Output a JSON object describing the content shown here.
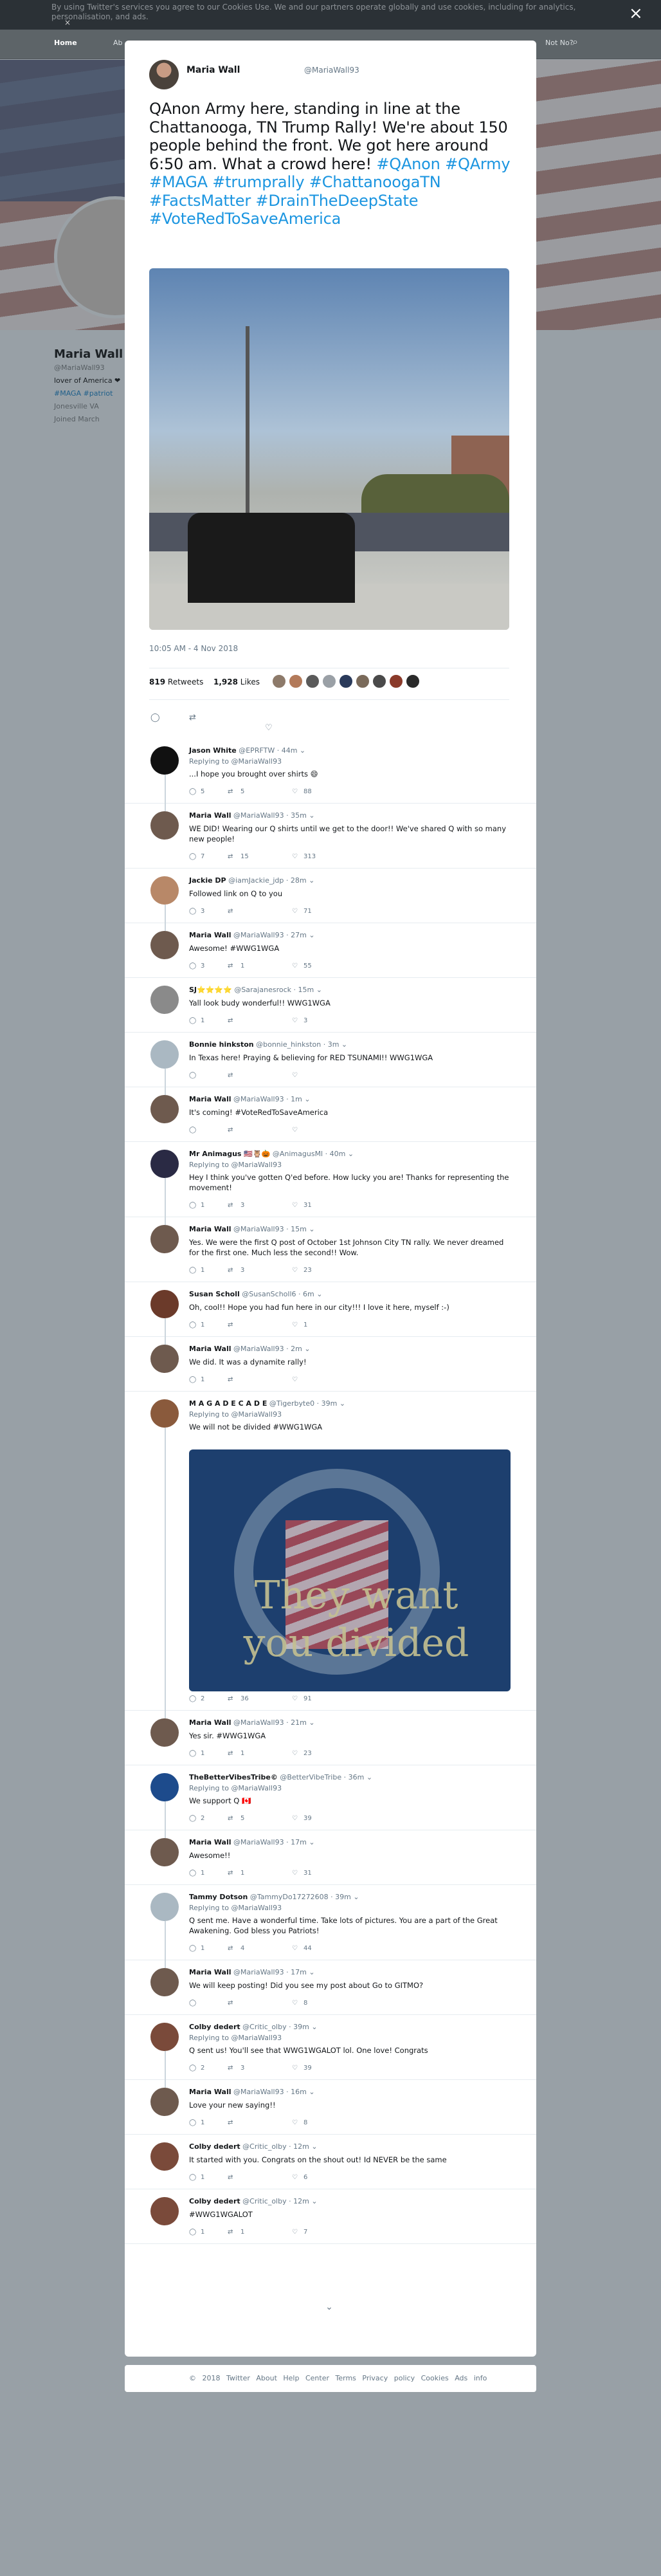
{
  "background": {
    "cookie_text": "By using Twitter's services you agree to our Cookies Use. We and our partners operate globally and use cookies, including for analytics, personalisation, and ads.",
    "cookie_close": "×",
    "nav_home": "Home",
    "nav_about": "Ab",
    "nav_right": "Not No?",
    "profile_name": "Maria Wall",
    "profile_handle": "@MariaWall93",
    "profile_bio": "lover of America ❤",
    "profile_tags": "#MAGA #patriot",
    "profile_location": "Jonesville VA",
    "profile_joined": "Joined March"
  },
  "modal_close": "×",
  "tweet": {
    "author_name": "Maria Wall",
    "author_handle": "@MariaWall93",
    "text_plain": "QAnon Army here, standing in line at the Chattanooga, TN Trump Rally! We're about 150 people behind the front. We got here around 6:50 am. What a crowd here!",
    "hashtags": "#QAnon #QArmy #MAGA #trumprally #ChattanoogaTN #FactsMatter #DrainTheDeepState #VoteRedToSaveAmerica",
    "timestamp": "10:05 AM - 4 Nov 2018",
    "retweets_count": "819",
    "retweets_label": "Retweets",
    "likes_count": "1,928",
    "likes_label": "Likes"
  },
  "replies": [
    {
      "name": "Jason White",
      "handle": "@EPRFTW",
      "time": "44m",
      "replying": "Replying to @MariaWall93",
      "text": "...I hope you brought over shirts 😄",
      "reply": "5",
      "rt": "5",
      "like": "88",
      "color": "#111111",
      "thread": false
    },
    {
      "name": "Maria Wall",
      "handle": "@MariaWall93",
      "time": "35m",
      "replying": "",
      "text": "WE DID! Wearing our Q shirts until we get to the door!! We've shared Q with so many new people!",
      "reply": "7",
      "rt": "15",
      "like": "313",
      "color": "#6e5a4e",
      "thread": true
    },
    {
      "name": "Jackie DP",
      "handle": "@iamJackie_jdp",
      "time": "28m",
      "replying": "",
      "text": "Followed link on Q to you",
      "reply": "3",
      "rt": "",
      "like": "71",
      "color": "#b88868",
      "thread": false
    },
    {
      "name": "Maria Wall",
      "handle": "@MariaWall93",
      "time": "27m",
      "replying": "",
      "text": "Awesome! #WWG1WGA",
      "reply": "3",
      "rt": "1",
      "like": "55",
      "color": "#6e5a4e",
      "thread": true
    },
    {
      "name": "SJ⭐⭐⭐⭐",
      "handle": "@Sarajanesrock",
      "time": "15m",
      "replying": "",
      "text": "Yall look budy wonderful!! WWG1WGA",
      "reply": "1",
      "rt": "",
      "like": "3",
      "color": "#8a8a8a",
      "thread": false
    },
    {
      "name": "Bonnie hinkston",
      "handle": "@bonnie_hinkston",
      "time": "3m",
      "replying": "",
      "text": "In Texas here! Praying & believing for RED TSUNAMI!!  WWG1WGA",
      "reply": "",
      "rt": "",
      "like": "",
      "color": "#aab8c2",
      "thread": false
    },
    {
      "name": "Maria Wall",
      "handle": "@MariaWall93",
      "time": "1m",
      "replying": "",
      "text": "It's coming! #VoteRedToSaveAmerica",
      "reply": "",
      "rt": "",
      "like": "",
      "color": "#6e5a4e",
      "thread": true
    },
    {
      "name": "Mr Animagus 🇺🇸🦉🎃",
      "handle": "@AnimagusMl",
      "time": "40m",
      "replying": "Replying to @MariaWall93",
      "text": "Hey I think you've gotten Q'ed before. How lucky you are! Thanks for representing the movement!",
      "reply": "1",
      "rt": "3",
      "like": "31",
      "color": "#2a2a44",
      "thread": false
    },
    {
      "name": "Maria Wall",
      "handle": "@MariaWall93",
      "time": "15m",
      "replying": "",
      "text": "Yes. We were the first Q post of October 1st  Johnson City TN rally. We never dreamed for the first one.  Much less the second!! Wow.",
      "reply": "1",
      "rt": "3",
      "like": "23",
      "color": "#6e5a4e",
      "thread": true
    },
    {
      "name": "Susan Scholl",
      "handle": "@SusanScholl6",
      "time": "6m",
      "replying": "",
      "text": "Oh, cool!! Hope you had fun here in our city!!! I love it here, myself  :-)",
      "reply": "1",
      "rt": "",
      "like": "1",
      "color": "#6b3a2a",
      "thread": false
    },
    {
      "name": "Maria Wall",
      "handle": "@MariaWall93",
      "time": "2m",
      "replying": "",
      "text": "We did. It was a dynamite rally!",
      "reply": "1",
      "rt": "",
      "like": "",
      "color": "#6e5a4e",
      "thread": true
    },
    {
      "name": "M A G A D E C A D E",
      "handle": "@Tigerbyte0",
      "time": "39m",
      "replying": "Replying to @MariaWall93",
      "text": "We will not be divided #WWG1WGA",
      "reply": "2",
      "rt": "36",
      "like": "91",
      "color": "#8a5a3c",
      "thread": false,
      "image_caption": "They want you divided"
    },
    {
      "name": "Maria Wall",
      "handle": "@MariaWall93",
      "time": "21m",
      "replying": "",
      "text": "Yes sir. #WWG1WGA",
      "reply": "1",
      "rt": "1",
      "like": "23",
      "color": "#6e5a4e",
      "thread": true
    },
    {
      "name": "TheBetterVibesTribe©",
      "handle": "@BetterVibeTribe",
      "time": "36m",
      "replying": "Replying to @MariaWall93",
      "text": "We support Q 🇨🇦",
      "reply": "2",
      "rt": "5",
      "like": "39",
      "color": "#1d4b8c",
      "thread": false
    },
    {
      "name": "Maria Wall",
      "handle": "@MariaWall93",
      "time": "17m",
      "replying": "",
      "text": "Awesome!!",
      "reply": "1",
      "rt": "1",
      "like": "31",
      "color": "#6e5a4e",
      "thread": true
    },
    {
      "name": "Tammy Dotson",
      "handle": "@TammyDo17272608",
      "time": "39m",
      "replying": "Replying to @MariaWall93",
      "text": "Q sent me. Have a wonderful time. Take lots of pictures. You are a part of the Great Awakening. God bless you Patriots!",
      "reply": "1",
      "rt": "4",
      "like": "44",
      "color": "#aab8c2",
      "thread": false
    },
    {
      "name": "Maria Wall",
      "handle": "@MariaWall93",
      "time": "17m",
      "replying": "",
      "text": "We will keep posting! Did you see my post about Go to GITMO?",
      "reply": "",
      "rt": "",
      "like": "8",
      "color": "#6e5a4e",
      "thread": true
    },
    {
      "name": "Colby dedert",
      "handle": "@Critic_olby",
      "time": "39m",
      "replying": "Replying to @MariaWall93",
      "text": "Q sent us! You'll see that WWG1WGALOT lol. One love! Congrats",
      "reply": "2",
      "rt": "3",
      "like": "39",
      "color": "#7a4a3a",
      "thread": false
    },
    {
      "name": "Maria Wall",
      "handle": "@MariaWall93",
      "time": "16m",
      "replying": "",
      "text": "Love your new saying!!",
      "reply": "1",
      "rt": "",
      "like": "8",
      "color": "#6e5a4e",
      "thread": true
    },
    {
      "name": "Colby dedert",
      "handle": "@Critic_olby",
      "time": "12m",
      "replying": "",
      "text": "It started with you. Congrats on the shout out! Id NEVER be the same",
      "reply": "1",
      "rt": "",
      "like": "6",
      "color": "#7a4a3a",
      "thread": false
    },
    {
      "name": "Colby dedert",
      "handle": "@Critic_olby",
      "time": "12m",
      "replying": "",
      "text": "#WWG1WGALOT",
      "reply": "1",
      "rt": "1",
      "like": "7",
      "color": "#7a4a3a",
      "thread": false
    }
  ],
  "show_more": "⌄",
  "footer": {
    "copyright": "© 2018 Twitter",
    "links": [
      "About",
      "Help Center",
      "Terms",
      "Privacy policy",
      "Cookies",
      "Ads info"
    ]
  }
}
